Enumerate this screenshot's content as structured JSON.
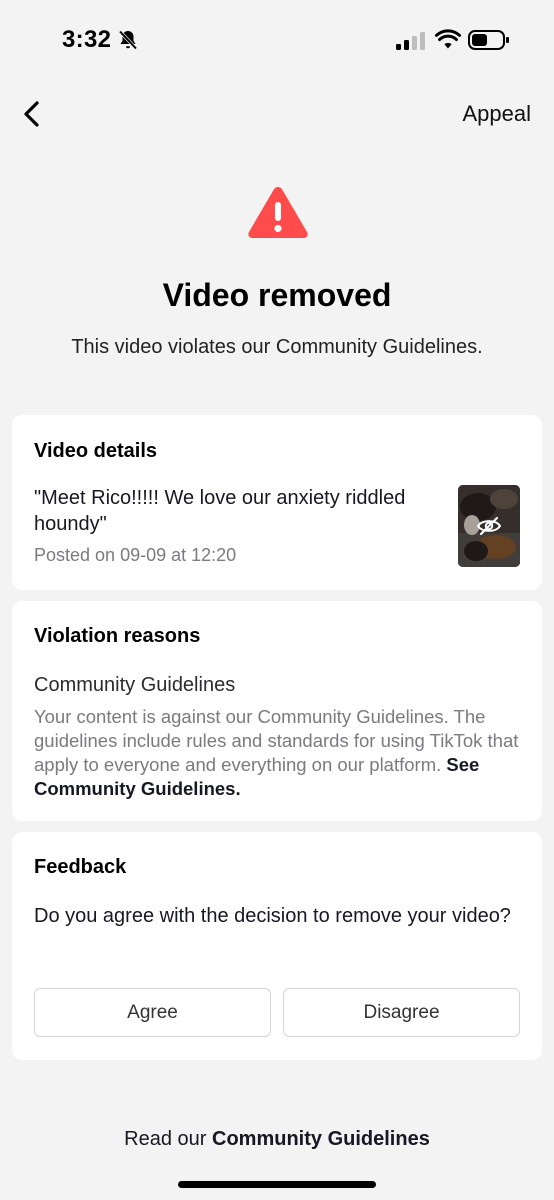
{
  "status_bar": {
    "time": "3:32",
    "icons": [
      "bell-slash-icon",
      "signal-icon",
      "wifi-icon",
      "battery-icon"
    ]
  },
  "nav": {
    "back_icon": "chevron-left-icon",
    "appeal_label": "Appeal"
  },
  "hero": {
    "icon": "warning-triangle-icon",
    "icon_color": "#fe4b4b",
    "title": "Video removed",
    "subtitle": "This video violates our Community Guidelines."
  },
  "video_details": {
    "title": "Video details",
    "caption": "\"Meet Rico!!!!! We love our anxiety riddled houndy\"",
    "posted": "Posted on 09-09 at 12:20",
    "thumbnail_icon": "eye-slash-icon"
  },
  "violation": {
    "title": "Violation reasons",
    "reason": "Community Guidelines",
    "description": "Your content is against our Community Guidelines. The guidelines include rules and standards for using TikTok that apply to everyone and everything on our platform.",
    "link_label": "See Community Guidelines."
  },
  "feedback": {
    "title": "Feedback",
    "question": "Do you agree with the decision to remove your video?",
    "agree_label": "Agree",
    "disagree_label": "Disagree"
  },
  "footer": {
    "prefix": "Read our",
    "link_label": "Community Guidelines"
  },
  "colors": {
    "background": "#f3f3f3",
    "card": "#ffffff",
    "accent_warning": "#fe4b4b",
    "muted_text": "#7a7a80"
  }
}
